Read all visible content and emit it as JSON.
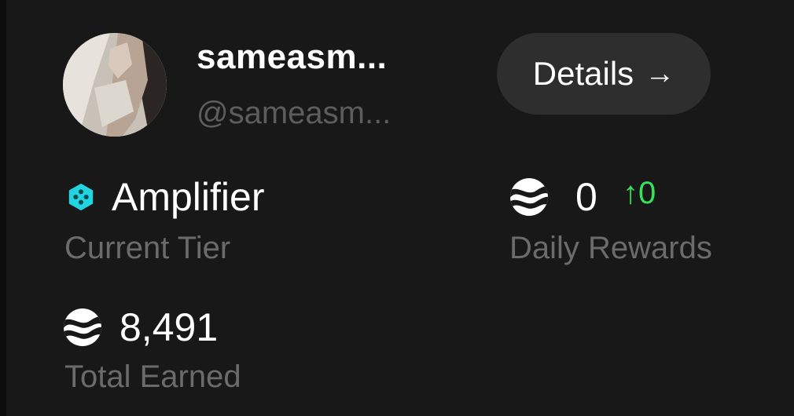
{
  "profile": {
    "display_name": "sameasm...",
    "handle": "@sameasm..."
  },
  "details_button": {
    "label": "Details",
    "icon": "arrow-right-icon",
    "arrow_glyph": "→"
  },
  "tier": {
    "name": "Amplifier",
    "label": "Current Tier",
    "icon": "tier-gem-icon",
    "icon_color": "#21d4e0"
  },
  "daily_rewards": {
    "value": "0",
    "change": "0",
    "change_arrow": "↑",
    "label": "Daily Rewards",
    "icon": "token-icon",
    "change_color": "#35e25a"
  },
  "total_earned": {
    "value": "8,491",
    "label": "Total Earned",
    "icon": "token-icon"
  }
}
